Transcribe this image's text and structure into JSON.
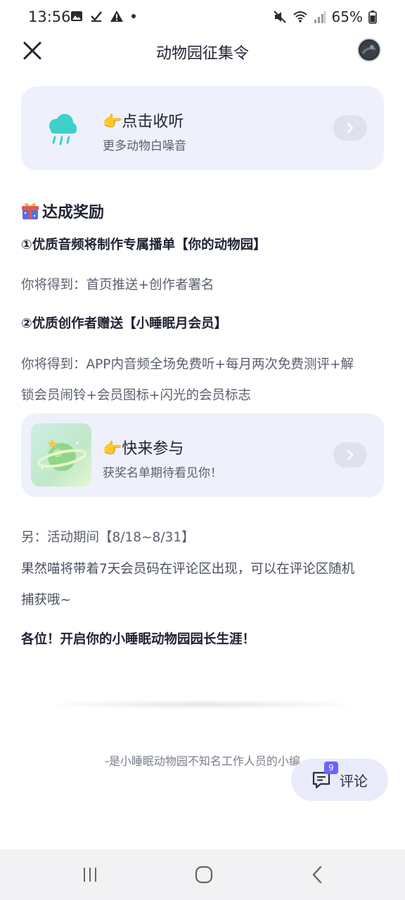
{
  "status_bar": {
    "time": "13:56",
    "battery": "65%",
    "left_icons": [
      "image-icon",
      "check-icon",
      "warning-icon",
      "dot-icon"
    ],
    "right_icons": [
      "mute-icon",
      "wifi-icon",
      "signal-icon",
      "battery-icon"
    ]
  },
  "header": {
    "title": "动物园征集令",
    "close_icon": "close-icon",
    "avatar": "avatar"
  },
  "listen_card": {
    "title": "点击收听",
    "subtitle": "更多动物白噪音",
    "icon": "rain-cloud-icon"
  },
  "reward": {
    "title": "达成奖励",
    "item1_title": "①优质音频将制作专属播单【你的动物园】",
    "item1_desc": "你将得到：首页推送+创作者署名",
    "item2_title": "②优质创作者赠送【小睡眠月会员】",
    "item2_desc_line1": "你将得到：APP内音频全场免费听+每月两次免费测评+解",
    "item2_desc_line2": "锁会员闹铃+会员图标+闪光的会员标志"
  },
  "join_card": {
    "title": "快来参与",
    "subtitle": "获奖名单期待看见你！",
    "thumb": "planet-thumbnail"
  },
  "extra": {
    "period": "另：活动期间【8/18~8/31】",
    "note_line1": "果然喵将带着7天会员码在评论区出现，可以在评论区随机",
    "note_line2": "捕获哦~",
    "cta": "各位！开启你的小睡眠动物园园长生涯！"
  },
  "signature": "-是小睡眠动物园不知名工作人员的小编",
  "comment_button": {
    "label": "评论",
    "count": "9"
  },
  "colors": {
    "card_bg": "#eef0fb",
    "accent": "#6c63ff",
    "rain_icon": "#3fd0c9"
  }
}
